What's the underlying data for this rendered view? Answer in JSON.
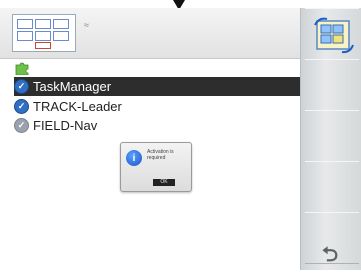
{
  "topbar": {
    "small_label": "≈"
  },
  "apps": {
    "items": [
      {
        "label": "TaskManager",
        "selected": true,
        "active": true
      },
      {
        "label": "TRACK-Leader",
        "selected": false,
        "active": true
      },
      {
        "label": "FIELD-Nav",
        "selected": false,
        "active": false
      }
    ]
  },
  "dialog": {
    "message": "Activation is required",
    "ok_label": "OK"
  },
  "colors": {
    "selected_bg": "#2d2d2d",
    "check_active": "#2f6fc4",
    "check_inactive": "#9aa3ad"
  },
  "icons": {
    "top_bar": "field-map-icon",
    "rail_top": "map-sync-icon",
    "rail_bottom": "back-arrow-icon",
    "puzzle": "puzzle-icon",
    "dialog": "info-icon"
  }
}
